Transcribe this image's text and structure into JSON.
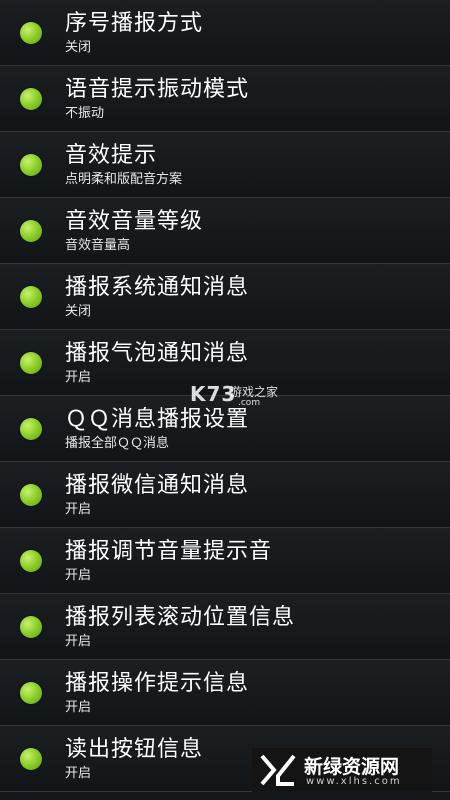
{
  "settings": [
    {
      "title": "序号播报方式",
      "subtitle": "关闭"
    },
    {
      "title": "语音提示振动模式",
      "subtitle": "不振动"
    },
    {
      "title": "音效提示",
      "subtitle": "点明柔和版配音方案"
    },
    {
      "title": "音效音量等级",
      "subtitle": "音效音量高"
    },
    {
      "title": "播报系统通知消息",
      "subtitle": "关闭"
    },
    {
      "title": "播报气泡通知消息",
      "subtitle": "开启"
    },
    {
      "title": "ＱＱ消息播报设置",
      "subtitle": "播报全部ＱＱ消息"
    },
    {
      "title": "播报微信通知消息",
      "subtitle": "开启"
    },
    {
      "title": "播报调节音量提示音",
      "subtitle": "开启"
    },
    {
      "title": "播报列表滚动位置信息",
      "subtitle": "开启"
    },
    {
      "title": "播报操作提示信息",
      "subtitle": "开启"
    },
    {
      "title": "读出按钮信息",
      "subtitle": "开启"
    }
  ],
  "watermark_k73": {
    "logo": "K73",
    "name": "游戏之家",
    "domain": ".com"
  },
  "watermark_xlhs": {
    "name": "新绿资源网",
    "url": "www.xlhs.com"
  },
  "colors": {
    "accent_dot": "#8fd12a",
    "background": "#15181b",
    "divider": "#33373b"
  }
}
